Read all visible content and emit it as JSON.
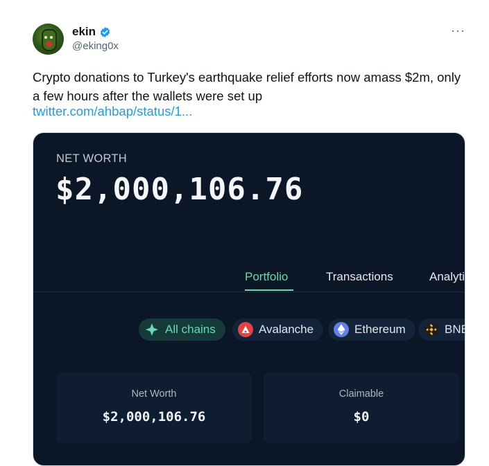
{
  "tweet": {
    "author_name": "ekin",
    "handle": "@eking0x",
    "more_menu": "···",
    "text": "Crypto donations to Turkey's earthquake relief efforts now amass $2m, only a few hours after the wallets were set up",
    "link_text": "twitter.com/ahbap/status/1..."
  },
  "card": {
    "net_worth_label": "NET WORTH",
    "net_worth_value": "$2,000,106.76",
    "tabs": [
      {
        "label": "Portfolio",
        "active": true
      },
      {
        "label": "Transactions",
        "active": false
      },
      {
        "label": "Analyti",
        "active": false
      }
    ],
    "chains": [
      {
        "label": "All chains",
        "icon": "diamond-cross-icon",
        "active": true
      },
      {
        "label": "Avalanche",
        "icon": "avalanche-icon",
        "active": false
      },
      {
        "label": "Ethereum",
        "icon": "ethereum-icon",
        "active": false
      },
      {
        "label": "BNB",
        "icon": "bnb-icon",
        "active": false
      }
    ],
    "stats": [
      {
        "label": "Net Worth",
        "value": "$2,000,106.76"
      },
      {
        "label": "Claimable",
        "value": "$0"
      }
    ]
  },
  "colors": {
    "link": "#1d9bf0",
    "card_bg": "#0b1626",
    "accent": "#66d9b3",
    "verified": "#1d9bf0"
  }
}
